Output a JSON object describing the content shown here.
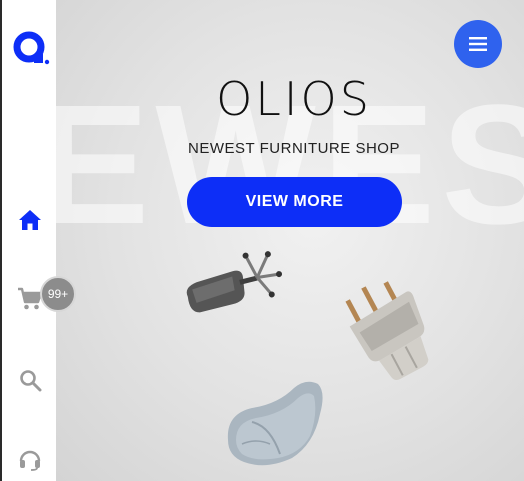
{
  "brand": {
    "logo_icon": "olios-logo-icon",
    "accent": "#0d2ef7"
  },
  "sidebar": {
    "items": [
      {
        "name": "home",
        "icon": "home-icon",
        "active": true
      },
      {
        "name": "cart",
        "icon": "cart-icon",
        "badge": "99+"
      },
      {
        "name": "search",
        "icon": "search-icon"
      },
      {
        "name": "support",
        "icon": "headset-icon"
      }
    ]
  },
  "hero": {
    "background_text": "EWES",
    "title": "OLIOS",
    "subtitle": "NEWEST FURNITURE SHOP",
    "cta_label": "VIEW MORE",
    "menu_icon": "hamburger-icon",
    "products": [
      {
        "name": "office-chair"
      },
      {
        "name": "wooden-chair"
      },
      {
        "name": "bean-bag"
      }
    ]
  },
  "colors": {
    "menu_button": "#2f62ee",
    "cta_button": "#0d2ef7",
    "badge": "#8c8c8c"
  }
}
